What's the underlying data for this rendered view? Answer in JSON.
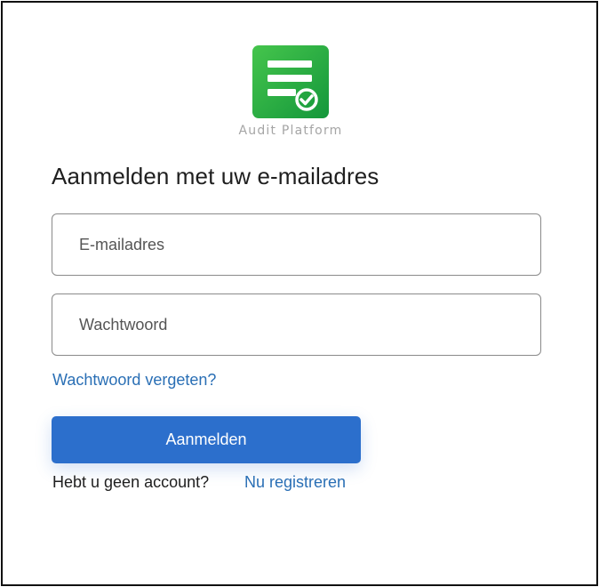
{
  "brand": {
    "name": "Audit Platform",
    "icon": "document-check-icon",
    "colors": {
      "tile_top": "#3fbf4a",
      "tile_bottom": "#169a3c"
    }
  },
  "form": {
    "heading": "Aanmelden met uw e-mailadres",
    "email": {
      "placeholder": "E-mailadres",
      "value": ""
    },
    "password": {
      "placeholder": "Wachtwoord",
      "value": ""
    },
    "forgot_label": "Wachtwoord vergeten?",
    "submit_label": "Aanmelden",
    "no_account_text": "Hebt u geen account?",
    "register_label": "Nu registreren"
  },
  "colors": {
    "accent": "#2c6fcc",
    "link": "#2a6fb5",
    "border": "#8a8a8a"
  }
}
